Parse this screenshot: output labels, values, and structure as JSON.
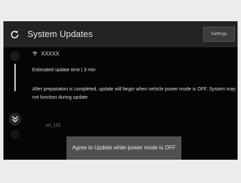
{
  "header": {
    "title": "System Updates",
    "settings_label": "Settings"
  },
  "content": {
    "network_name": "XXXXX",
    "estimated_time": "Estimated update time | 3 min",
    "message": "After preparation is completed, update will begin when vehicle power mode is OFF. System may not function during update.",
    "locale": "en_US"
  },
  "actions": {
    "agree_label": "Agree to Update while power mode is OFF"
  },
  "icons": {
    "refresh": "refresh-icon",
    "network": "wifi-icon",
    "scroll_down": "double-chevron-down-icon"
  },
  "colors": {
    "screen_background": "#050505",
    "header_background": "#232323",
    "button_background": "#505050",
    "text": "#dedede"
  }
}
